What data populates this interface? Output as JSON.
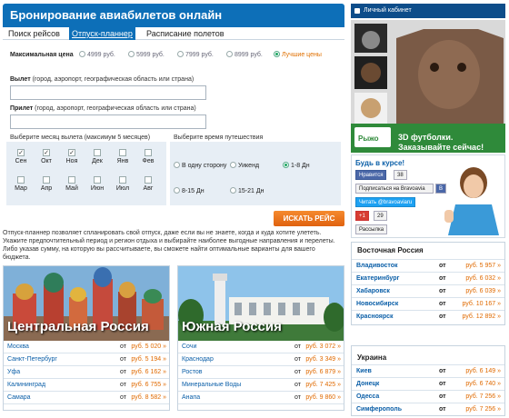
{
  "header": {
    "title": "Бронирование авиабилетов онлайн"
  },
  "tabs": [
    {
      "label": "Поиск рейсов"
    },
    {
      "label": "Отпуск-планнер"
    },
    {
      "label": "Расписание полетов"
    }
  ],
  "form": {
    "price_label": "Максимальная цена",
    "prices": [
      "4999 руб.",
      "5999 руб.",
      "7999 руб.",
      "8999 руб.",
      "Лучшие цены"
    ],
    "departure_label": "Вылет",
    "departure_hint": " (город, аэропорт, географическая область или страна)",
    "arrival_label": "Прилет",
    "arrival_hint": " (город, аэропорт, географическая область или страна)",
    "month_title": "Выберите месяц вылета (максимум 5 месяцев)",
    "months": [
      {
        "label": "Сен",
        "checked": "✓"
      },
      {
        "label": "Окт",
        "checked": "✓"
      },
      {
        "label": "Ноя",
        "checked": "✓"
      },
      {
        "label": "Дек",
        "checked": ""
      },
      {
        "label": "Янв",
        "checked": ""
      },
      {
        "label": "Фев",
        "checked": ""
      },
      {
        "label": "Мар",
        "checked": ""
      },
      {
        "label": "Апр",
        "checked": ""
      },
      {
        "label": "Май",
        "checked": ""
      },
      {
        "label": "Июн",
        "checked": ""
      },
      {
        "label": "Июл",
        "checked": ""
      },
      {
        "label": "Авг",
        "checked": ""
      }
    ],
    "time_title": "Выберите время путешествия",
    "trip_options": [
      "В одну сторону",
      "Уикенд",
      "1-8 Дн",
      "8-15 Дн",
      "15-21 Дн"
    ],
    "search_button": "ИСКАТЬ РЕЙС"
  },
  "description": "Отпуск-планнер позволяет спланировать свой отпуск, даже если вы не знаете, когда и куда хотите улететь. Укажите предпочтительный период и регион отдыха и выбирайте наиболее выгодные направления и перелеты. Либо указав сумму, на которую вы рассчитываете, вы сможете найти оптимальные варианты для вашего бюджета.",
  "regions": [
    {
      "title": "Центральная Россия",
      "rows": [
        {
          "city": "Москва",
          "from": "от",
          "price": "руб. 5 020 »"
        },
        {
          "city": "Санкт-Петербург",
          "from": "от",
          "price": "руб. 5 194 »"
        },
        {
          "city": "Уфа",
          "from": "от",
          "price": "руб. 6 162 »"
        },
        {
          "city": "Калининград",
          "from": "от",
          "price": "руб. 6 755 »"
        },
        {
          "city": "Самара",
          "from": "от",
          "price": "руб. 8 582 »"
        }
      ]
    },
    {
      "title": "Южная Россия",
      "rows": [
        {
          "city": "Сочи",
          "from": "от",
          "price": "руб. 3 072 »"
        },
        {
          "city": "Краснодар",
          "from": "от",
          "price": "руб. 3 349 »"
        },
        {
          "city": "Ростов",
          "from": "от",
          "price": "руб. 6 879 »"
        },
        {
          "city": "Минеральные Воды",
          "from": "от",
          "price": "руб. 7 425 »"
        },
        {
          "city": "Анапа",
          "from": "от",
          "price": "руб. 9 860 »"
        }
      ]
    }
  ],
  "sidebar": {
    "cabinet_label": "Личный кабинет",
    "ad_line1": "3D футболки.",
    "ad_line2": "Заказывайте сейчас!",
    "ad_logo": "Рыжо",
    "social_title": "Будь в курсе!",
    "like_label": "Нравится",
    "like_count": "38",
    "subscribe_label": "Подписаться на Bravoavia",
    "twitter_label": "Читать @bravoaviaru",
    "gplus_label": "+1",
    "gplus_count": "29",
    "mailing_label": "Рассылка"
  },
  "destinations": [
    {
      "title": "Восточная Россия",
      "rows": [
        {
          "city": "Владивосток",
          "from": "от",
          "price": "руб. 5 957 »"
        },
        {
          "city": "Екатеринбург",
          "from": "от",
          "price": "руб. 6 032 »"
        },
        {
          "city": "Хабаровск",
          "from": "от",
          "price": "руб. 6 039 »"
        },
        {
          "city": "Новосибирск",
          "from": "от",
          "price": "руб. 10 167 »"
        },
        {
          "city": "Красноярск",
          "from": "от",
          "price": "руб. 12 892 »"
        }
      ]
    },
    {
      "title": "Украина",
      "rows": [
        {
          "city": "Киев",
          "from": "от",
          "price": "руб. 6 149 »"
        },
        {
          "city": "Донецк",
          "from": "от",
          "price": "руб. 6 740 »"
        },
        {
          "city": "Одесса",
          "from": "от",
          "price": "руб. 7 256 »"
        },
        {
          "city": "Симферополь",
          "from": "от",
          "price": "руб. 7 256 »"
        }
      ]
    }
  ],
  "colors": {
    "brand_blue": "#0d6fb8",
    "accent_orange": "#e06a00",
    "ad_green": "#2f8a3a"
  }
}
